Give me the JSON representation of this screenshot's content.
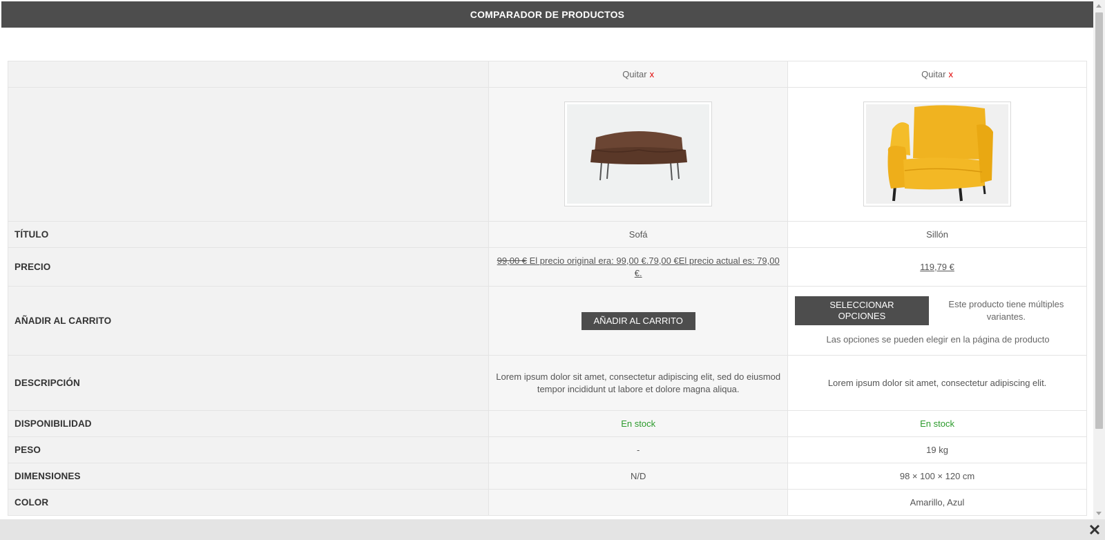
{
  "header": {
    "title": "COMPARADOR DE PRODUCTOS"
  },
  "products": [
    {
      "remove_label": "Quitar",
      "remove_x": "x",
      "image": "brown-sofa",
      "title": "Sofá",
      "price_old": "99,00 €",
      "price_text": "El precio original era: 99,00 €.79,00 €El precio actual es: 79,00 €.",
      "cart_button": "AÑADIR AL CARRITO",
      "description": "Lorem ipsum dolor sit amet, consectetur adipiscing elit, sed do eiusmod tempor incididunt ut labore et dolore magna aliqua.",
      "availability": "En stock",
      "weight": "-",
      "dimensions": "N/D",
      "color": ""
    },
    {
      "remove_label": "Quitar",
      "remove_x": "x",
      "image": "yellow-armchair",
      "title": "Sillón",
      "price": "119,79 €",
      "cart_button": "SELECCIONAR OPCIONES",
      "variants_note": "Este producto tiene múltiples variantes.",
      "variants_note2": "Las opciones se pueden elegir en la página de producto",
      "description": "Lorem ipsum dolor sit amet, consectetur adipiscing elit.",
      "availability": "En stock",
      "weight": "19 kg",
      "dimensions": "98 × 100 × 120 cm",
      "color": "Amarillo, Azul"
    }
  ],
  "labels": {
    "title": "TÍTULO",
    "price": "PRECIO",
    "add_to_cart": "AÑADIR AL CARRITO",
    "description": "DESCRIPCIÓN",
    "availability": "DISPONIBILIDAD",
    "weight": "PESO",
    "dimensions": "DIMENSIONES",
    "color": "COLOR"
  },
  "colors": {
    "header_bg": "#4d4d4d",
    "remove_x": "#e00000",
    "in_stock": "#2b9a2b",
    "button_bg": "#4d4d4d"
  },
  "icons": {
    "close": "close-icon"
  }
}
